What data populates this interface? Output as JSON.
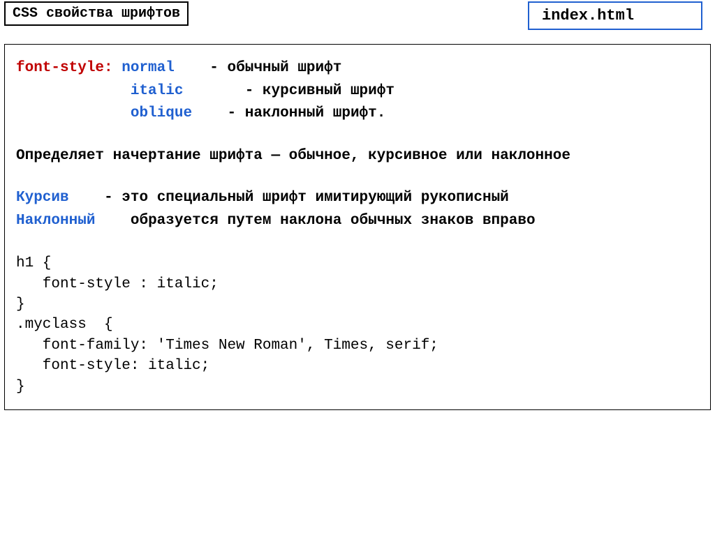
{
  "header": {
    "title": "CSS свойства шрифтов",
    "filename": "index.html"
  },
  "prop": {
    "name": "font-style:",
    "val1": "normal",
    "dash1": "- ",
    "desc1": "обычный шрифт",
    "val2": "italic",
    "dash2": "- ",
    "desc2": "курсивный шрифт",
    "val3": "oblique",
    "dash3": "- ",
    "desc3": "наклонный шрифт."
  },
  "heading": "Определяет начертание шрифта — обычное, курсивное или наклонное",
  "kursiv": {
    "term": "Курсив",
    "dash": "- ",
    "text": "это специальный шрифт имитирующий рукописный"
  },
  "naklon": {
    "term": "Наклонный",
    "text": "образуется путем наклона обычных знаков вправо"
  },
  "code": "h1 {\n   font-style : italic;\n}\n.myclass  {\n   font-family: 'Times New Roman', Times, serif;\n   font-style: italic;\n}"
}
